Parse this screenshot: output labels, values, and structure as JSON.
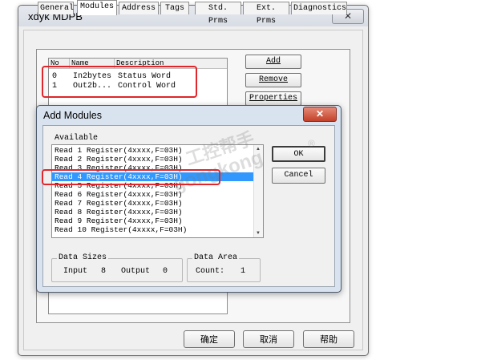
{
  "window": {
    "title": "xdyk MDPB",
    "close_icon": "close-icon"
  },
  "tabs": [
    {
      "label": "General"
    },
    {
      "label": "Modules"
    },
    {
      "label": "Address"
    },
    {
      "label": "Tags"
    },
    {
      "label": "Std. Prms"
    },
    {
      "label": "Ext. Prms"
    },
    {
      "label": "Diagnostics"
    }
  ],
  "modules_list": {
    "columns": [
      "No",
      "Name",
      "Description"
    ],
    "rows": [
      {
        "no": "0",
        "name": "In2bytes",
        "description": "Status Word"
      },
      {
        "no": "1",
        "name": "Out2b...",
        "description": "Control Word"
      }
    ]
  },
  "side_buttons": {
    "add": "Add",
    "remove": "Remove",
    "properties": "Properties"
  },
  "dialog": {
    "title": "Add Modules",
    "available_label": "Available",
    "items": [
      "Read 1 Register(4xxxx,F=03H)",
      "Read 2 Register(4xxxx,F=03H)",
      "Read 3 Register(4xxxx,F=03H)",
      "Read 4 Register(4xxxx,F=03H)",
      "Read 5 Register(4xxxx,F=03H)",
      "Read 6 Register(4xxxx,F=03H)",
      "Read 7 Register(4xxxx,F=03H)",
      "Read 8 Register(4xxxx,F=03H)",
      "Read 9 Register(4xxxx,F=03H)",
      "Read 10 Register(4xxxx,F=03H)"
    ],
    "selected_index": 3,
    "ok": "OK",
    "cancel": "Cancel",
    "data_sizes": {
      "title": "Data Sizes",
      "input_label": "Input",
      "input_value": "8",
      "output_label": "Output",
      "output_value": "0"
    },
    "data_area": {
      "title": "Data Area",
      "count_label": "Count:",
      "count_value": "1"
    }
  },
  "bottom_buttons": {
    "ok": "确定",
    "cancel": "取消",
    "help": "帮助"
  },
  "watermark": {
    "cn": "工控帮手",
    "en": "gongkong",
    "reg": "®"
  },
  "colors": {
    "selection": "#3298fe",
    "highlight_box": "#e0262b"
  }
}
